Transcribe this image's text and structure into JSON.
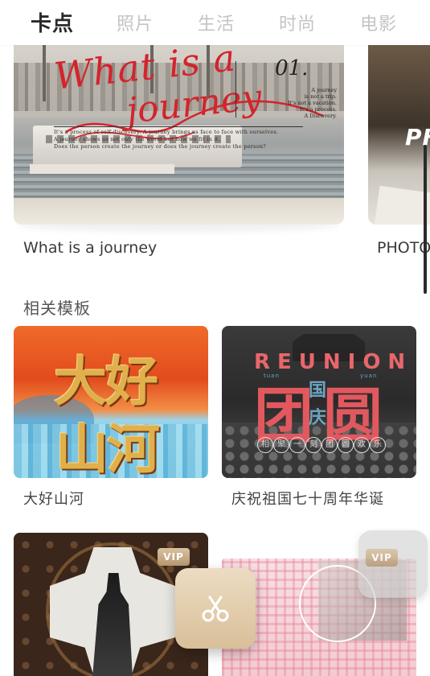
{
  "tabs": [
    {
      "label": "卡点",
      "active": true
    },
    {
      "label": "照片",
      "active": false
    },
    {
      "label": "生活",
      "active": false
    },
    {
      "label": "时尚",
      "active": false
    },
    {
      "label": "电影",
      "active": false
    }
  ],
  "featured": {
    "card": {
      "script_title_1": "What is a",
      "script_title_2": "journey",
      "number": "01.",
      "notes": "A journey\nis not a trip.\nIt's not a vacation.\nIt's a process.\nA Discovery.",
      "paragraph": "It's a process of self-discovery. A journey brings us face to face with ourselves.\nA journey shows us not only the world but how we fit in it.\nDoes the person create the journey or does the journey create the person?",
      "label": "What is a journey"
    },
    "peek_card": {
      "text": "PH",
      "label": "PHOTO"
    }
  },
  "related": {
    "title": "相关模板",
    "items": [
      {
        "label": "大好山河",
        "art_line1": "大好",
        "art_line2": "山河"
      },
      {
        "label": "庆祝祖国七十周年华诞",
        "art_word": "REUNION",
        "art_sub1": "tuan",
        "art_sub2": "yuan",
        "art_big1": "团",
        "art_small1": "国",
        "art_small2": "庆",
        "art_big2": "圆",
        "strip": [
          "相",
          "聚",
          "一",
          "刻",
          "团",
          "圆",
          "欢",
          "乐"
        ]
      },
      {
        "vip": "VIP"
      },
      {
        "vip": "VIP"
      }
    ]
  },
  "floating": {
    "cut_icon": "scissors-icon"
  },
  "colors": {
    "active_tab": "#2a2a2a",
    "inactive_tab": "#c4c4c4",
    "script_red": "#d3242c",
    "vip_gold": "#b69670"
  }
}
